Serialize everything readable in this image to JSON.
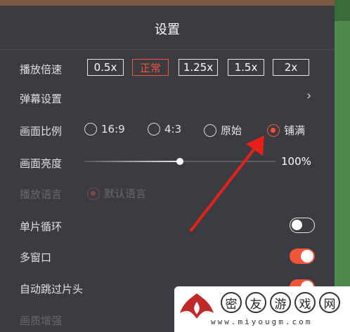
{
  "title": "设置",
  "playback_speed": {
    "label": "播放倍速",
    "options": [
      "0.5x",
      "正常",
      "1.25x",
      "1.5x",
      "2x"
    ],
    "selected": "正常"
  },
  "danmaku": {
    "label": "弹幕设置"
  },
  "aspect_ratio": {
    "label": "画面比例",
    "options": [
      "16:9",
      "4:3",
      "原始",
      "铺满"
    ],
    "selected": "铺满"
  },
  "brightness": {
    "label": "画面亮度",
    "value_text": "100%",
    "level": 0.5
  },
  "audio_language": {
    "label": "播放语言",
    "option": "默认语言",
    "disabled": true
  },
  "single_loop": {
    "label": "单片循环",
    "on": false
  },
  "multi_window": {
    "label": "多窗口",
    "on": true
  },
  "skip_intro": {
    "label": "自动跳过片头",
    "on": true
  },
  "quality_enhance": {
    "label": "画质增强"
  },
  "watermark": {
    "chars": [
      "密",
      "友",
      "游",
      "戏",
      "网"
    ],
    "url": "www.miyougm.com"
  },
  "colors": {
    "accent": "#f0553a",
    "panel": "#3b3c42",
    "arrow": "#e8201a"
  }
}
